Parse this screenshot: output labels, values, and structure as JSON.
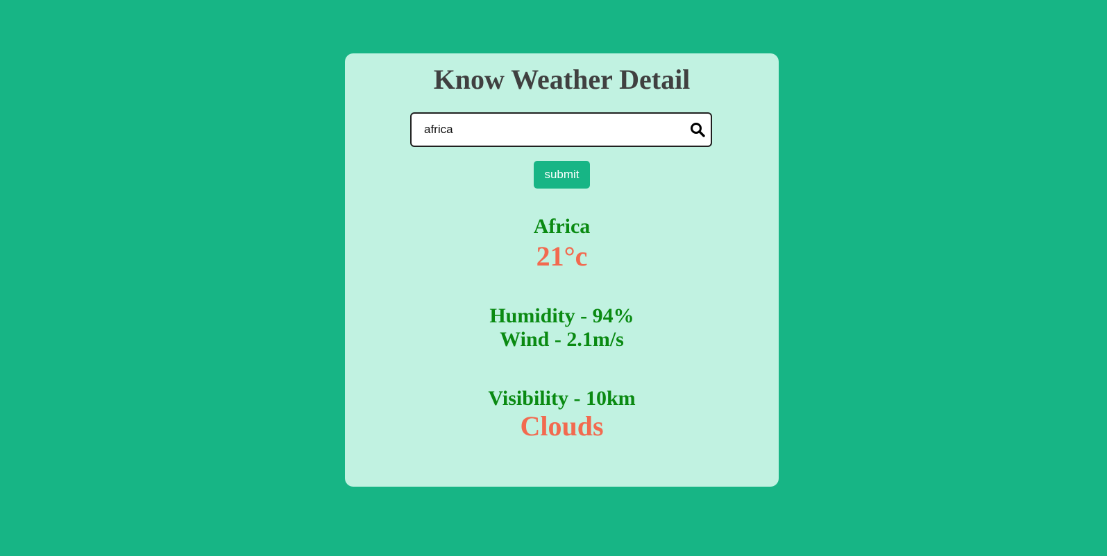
{
  "app": {
    "title": "Know Weather Detail"
  },
  "search": {
    "value": "africa",
    "placeholder": "",
    "icon": "search-icon"
  },
  "actions": {
    "submit_label": "submit"
  },
  "weather": {
    "city": "Africa",
    "temperature": "21°c",
    "humidity": "Humidity - 94%",
    "wind": "Wind - 2.1m/s",
    "visibility": "Visibility - 10km",
    "condition": "Clouds"
  },
  "colors": {
    "background": "#17b585",
    "card": "#c1f2e1",
    "title": "#404040",
    "detail_text": "#0a8a12",
    "highlight_text": "#f26a4f",
    "button": "#17b585"
  }
}
